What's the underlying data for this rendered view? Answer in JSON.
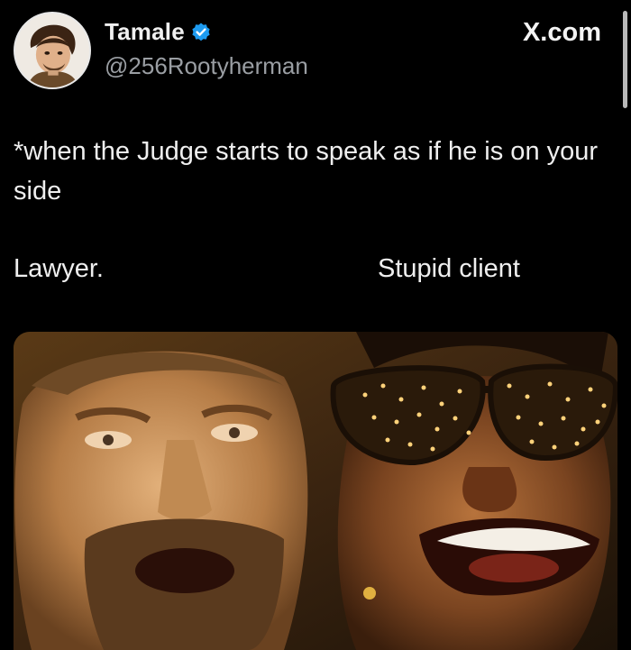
{
  "header": {
    "display_name": "Tamale",
    "handle": "@256Rootyherman",
    "site": "X.com"
  },
  "tweet": {
    "text": "*when the Judge starts to speak as if he is on your side",
    "caption_left": "Lawyer.",
    "caption_right": "Stupid client"
  },
  "icons": {
    "verified": "verified-badge-icon",
    "avatar": "avatar"
  },
  "colors": {
    "background": "#000000",
    "text": "#efefef",
    "secondary_text": "#9a9ea3",
    "verified_blue": "#1d9bf0"
  }
}
